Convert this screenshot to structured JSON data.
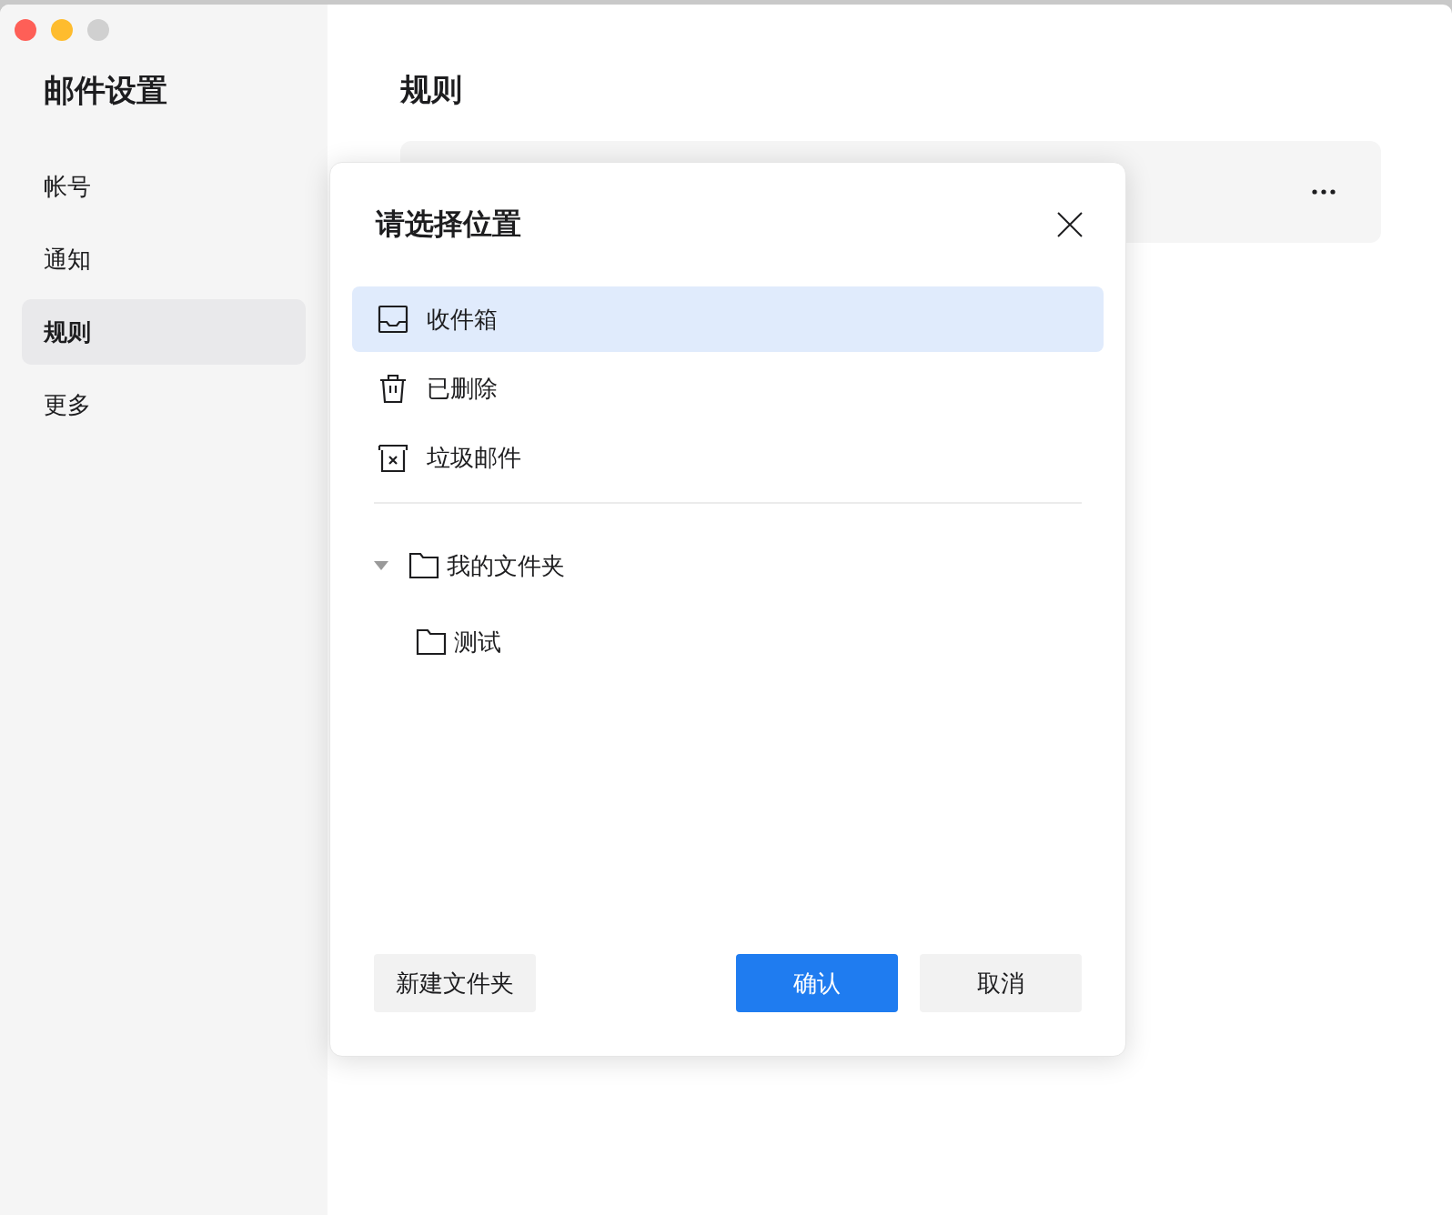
{
  "window": {
    "controls": [
      {
        "color": "#fe5f57"
      },
      {
        "color": "#febc2e"
      },
      {
        "color": "#d0d0d0"
      }
    ]
  },
  "sidebar": {
    "title": "邮件设置",
    "items": [
      {
        "label": "帐号",
        "selected": false
      },
      {
        "label": "通知",
        "selected": false
      },
      {
        "label": "规则",
        "selected": true
      },
      {
        "label": "更多",
        "selected": false
      }
    ]
  },
  "main": {
    "title": "规则"
  },
  "dialog": {
    "title": "请选择位置",
    "locations": [
      {
        "label": "收件箱",
        "kind": "inbox",
        "selected": true
      },
      {
        "label": "已删除",
        "kind": "trash",
        "selected": false
      },
      {
        "label": "垃圾邮件",
        "kind": "junk",
        "selected": false
      }
    ],
    "folders": [
      {
        "label": "我的文件夹",
        "expanded": true,
        "selected": false,
        "children": [
          {
            "label": "测试",
            "selected": false
          }
        ]
      }
    ],
    "buttons": [
      {
        "label": "新建文件夹",
        "kind": "secondary"
      },
      {
        "label": "确认",
        "kind": "primary"
      },
      {
        "label": "取消",
        "kind": "secondary"
      }
    ]
  }
}
